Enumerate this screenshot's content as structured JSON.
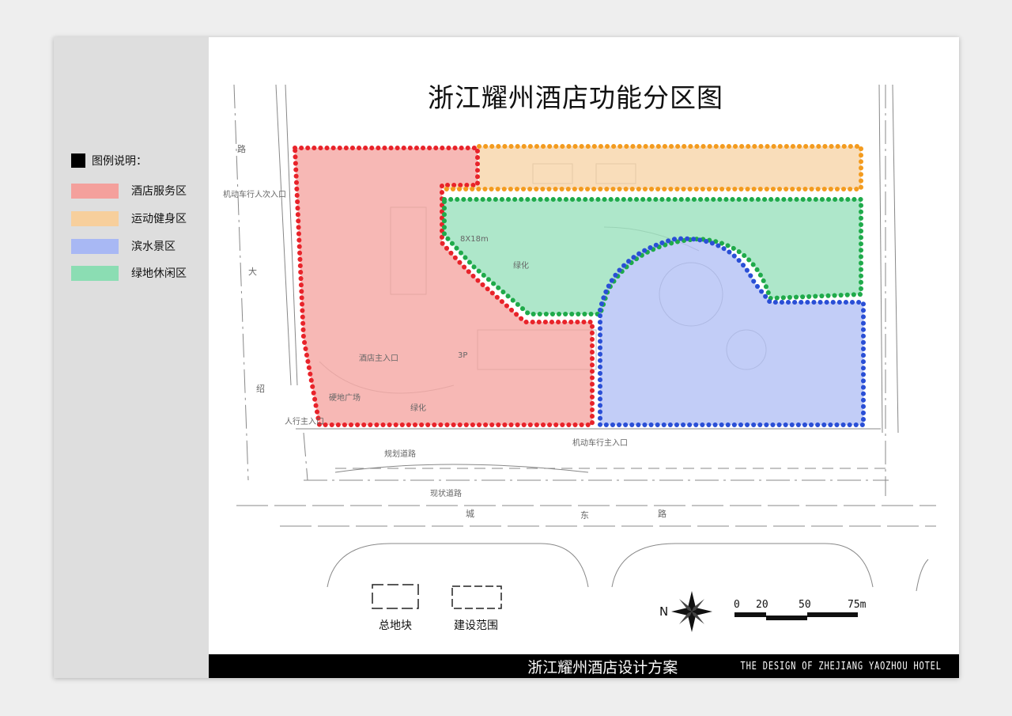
{
  "title": "浙江耀州酒店功能分区图",
  "legend": {
    "heading": "图例说明：",
    "items": [
      {
        "label": "酒店服务区",
        "color": "#f4a09c"
      },
      {
        "label": "运动健身区",
        "color": "#f7cf9c"
      },
      {
        "label": "滨水景区",
        "color": "#a8b8f4"
      },
      {
        "label": "绿地休闲区",
        "color": "#8bddb3"
      }
    ]
  },
  "zone_colors": {
    "hotel_service": "#f4a09c",
    "sports": "#f7cf9c",
    "waterfront": "#a8b8f4",
    "green_leisure": "#8bddb3",
    "dot_red": "#e8232a",
    "dot_orange": "#f39b1f",
    "dot_blue": "#2a4fd6",
    "dot_green": "#1faa4a"
  },
  "plan_labels": {
    "vehicle_secondary_entrance": "机动车行人次入口",
    "planned_road": "规划道路",
    "current_road": "现状道路",
    "vehicle_main_entrance": "机动车行主入口",
    "pedestrian_main_entrance": "人行主入口",
    "hotel_main_entrance": "酒店主入口",
    "hard_plaza": "硬地广场",
    "greening": "绿化",
    "dimension": "8X18m",
    "floors_3p": "3P",
    "road_chars": [
      "路",
      "大",
      "绍"
    ],
    "city_east_road": [
      "城",
      "东",
      "路"
    ]
  },
  "frame_legend": {
    "total_plot": "总地块",
    "construction_scope": "建设范围"
  },
  "compass": {
    "north": "N"
  },
  "scale_bar": {
    "ticks": [
      "0",
      "20",
      "50",
      "75m"
    ]
  },
  "footer": {
    "cn": "浙江耀州酒店设计方案",
    "en": "THE DESIGN OF ZHEJIANG YAOZHOU HOTEL"
  }
}
